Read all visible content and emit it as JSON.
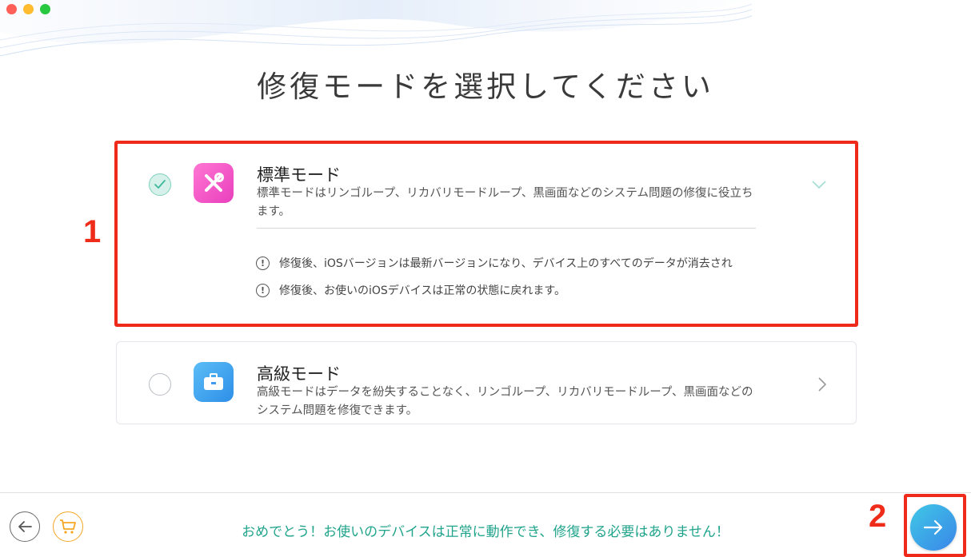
{
  "window": {
    "controls": [
      "close",
      "minimize",
      "zoom"
    ]
  },
  "page": {
    "title": "修復モードを選択してください"
  },
  "modes": [
    {
      "title": "標準モード",
      "description": "標準モードはリンゴループ、リカバリモードループ、黒画面などのシステム問題の修復に役立ちます。",
      "selected": true,
      "icon": "tools-icon",
      "warnings": [
        "修復後、iOSバージョンは最新バージョンになり、デバイス上のすべてのデータが消去され",
        "修復後、お使いのiOSデバイスは正常の状態に戻れます。"
      ]
    },
    {
      "title": "高級モード",
      "description": "高級モードはデータを紛失することなく、リンゴループ、リカバリモードループ、黒画面などのシステム問題を修復できます。",
      "selected": false,
      "icon": "briefcase-icon"
    }
  ],
  "annotations": {
    "label1": "1",
    "label2": "2",
    "color": "#f02a1a"
  },
  "footer": {
    "message": "おめでとう！お使いのデバイスは正常に動作でき、修復する必要はありません！",
    "message_color": "#21a48c"
  },
  "colors": {
    "accent_teal": "#7fd0bc",
    "next_button": "#3a86e8",
    "cart": "#f5a623"
  }
}
